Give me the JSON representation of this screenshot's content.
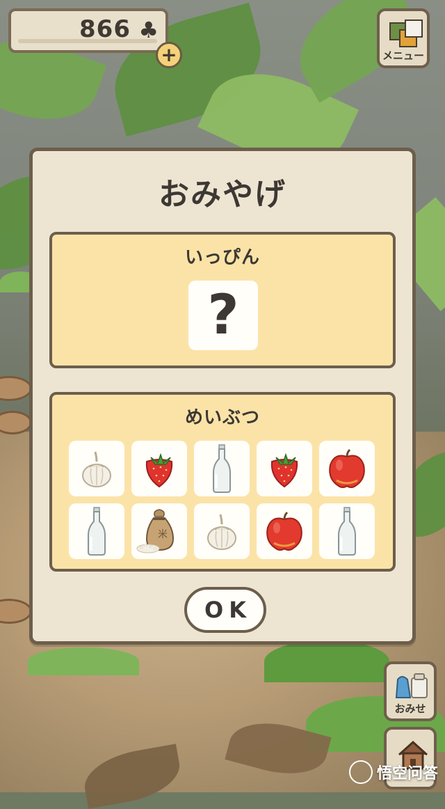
{
  "currency": {
    "value": "866",
    "icon": "clover-icon",
    "add_icon": "plus-icon",
    "add_symbol": "+",
    "clover_symbol": "♣"
  },
  "menu_button": {
    "label": "メニュー",
    "icon": "menu-icon"
  },
  "shop_button": {
    "label": "おみせ",
    "icon": "shop-bag-icon"
  },
  "home_button": {
    "icon": "house-icon"
  },
  "modal": {
    "title": "おみやげ",
    "specialty": {
      "title": "いっぴん",
      "placeholder": "?"
    },
    "souvenirs": {
      "title": "めいぶつ",
      "items": [
        {
          "icon": "garlic-icon"
        },
        {
          "icon": "strawberry-icon"
        },
        {
          "icon": "glass-bottle-icon"
        },
        {
          "icon": "strawberry-icon"
        },
        {
          "icon": "apple-icon"
        },
        {
          "icon": "glass-bottle-icon"
        },
        {
          "icon": "rice-sack-icon"
        },
        {
          "icon": "garlic-icon"
        },
        {
          "icon": "apple-icon"
        },
        {
          "icon": "glass-bottle-icon"
        }
      ]
    },
    "ok_label": "OK"
  },
  "watermark": {
    "text": "悟空问答"
  },
  "colors": {
    "panel": "#fbe3a8",
    "modal": "#ede5d2",
    "border": "#6d5e4c",
    "text": "#3d3833"
  }
}
